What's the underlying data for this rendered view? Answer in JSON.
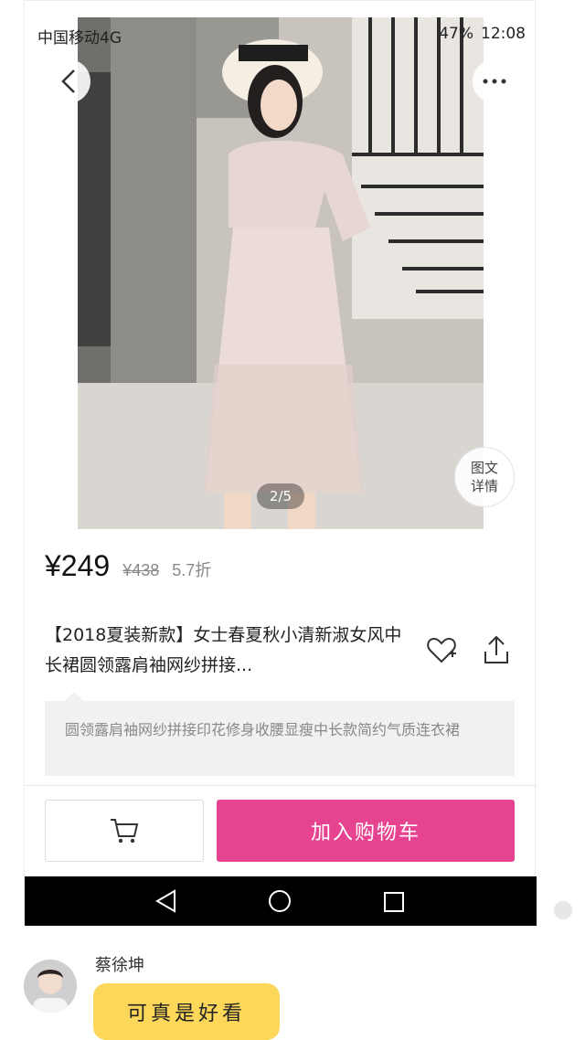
{
  "status_bar": {
    "carrier": "中国移动4G",
    "battery": "47%",
    "time": "12:08"
  },
  "gallery": {
    "page_indicator": "2/5",
    "detail_button_line1": "图文",
    "detail_button_line2": "详情"
  },
  "product": {
    "price": "¥249",
    "original_price": "¥438",
    "discount": "5.7折",
    "title": "【2018夏装新款】女士春夏秋小清新淑女风中长裙圆领露肩袖网纱拼接...",
    "description": "圆领露肩袖网纱拼接印花修身收腰显瘦中长款简约气质连衣裙"
  },
  "actions": {
    "add_to_cart_label": "加入购物车"
  },
  "chat": {
    "sender_name": "蔡徐坤",
    "message": "可真是好看"
  },
  "colors": {
    "accent": "#e64390",
    "bubble": "#fcd75a"
  },
  "icons": {
    "back": "chevron-left-icon",
    "more": "more-dots-icon",
    "favorite": "heart-plus-icon",
    "share": "share-icon",
    "cart": "cart-icon",
    "nav_back": "triangle-back-icon",
    "nav_home": "circle-home-icon",
    "nav_recent": "square-recent-icon"
  }
}
